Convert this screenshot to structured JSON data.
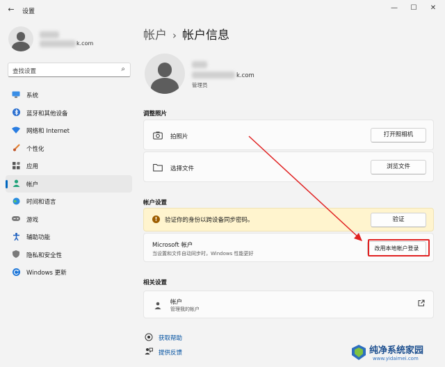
{
  "window": {
    "title": "设置",
    "back_icon": "back-arrow-icon",
    "minimize_icon": "minimize-icon",
    "maximize_icon": "maximize-icon",
    "close_icon": "close-icon"
  },
  "profile": {
    "email_suffix": "k.com"
  },
  "search": {
    "placeholder": "查找设置"
  },
  "sidebar": {
    "items": [
      {
        "label": "系统",
        "icon": "system-icon",
        "active": false
      },
      {
        "label": "蓝牙和其他设备",
        "icon": "bluetooth-icon",
        "active": false
      },
      {
        "label": "网络和 Internet",
        "icon": "network-icon",
        "active": false
      },
      {
        "label": "个性化",
        "icon": "brush-icon",
        "active": false
      },
      {
        "label": "应用",
        "icon": "apps-icon",
        "active": false
      },
      {
        "label": "帐户",
        "icon": "account-icon",
        "active": true
      },
      {
        "label": "时间和语言",
        "icon": "globe-icon",
        "active": false
      },
      {
        "label": "游戏",
        "icon": "gamepad-icon",
        "active": false
      },
      {
        "label": "辅助功能",
        "icon": "accessibility-icon",
        "active": false
      },
      {
        "label": "隐私和安全性",
        "icon": "shield-icon",
        "active": false
      },
      {
        "label": "Windows 更新",
        "icon": "update-icon",
        "active": false
      }
    ]
  },
  "breadcrumb": {
    "parent": "帐户",
    "separator": "›",
    "current": "帐户信息"
  },
  "account": {
    "email_suffix": "k.com",
    "role": "管理员"
  },
  "photo_section": {
    "heading": "调整照片",
    "rows": [
      {
        "label": "拍照片",
        "icon": "camera-icon",
        "button": "打开照相机"
      },
      {
        "label": "选择文件",
        "icon": "folder-icon",
        "button": "浏览文件"
      }
    ]
  },
  "account_settings": {
    "heading": "帐户设置",
    "warning": {
      "text": "验证你的身份以跨设备同步密码。",
      "icon": "warning-icon",
      "button": "验证"
    },
    "microsoft": {
      "title": "Microsoft 帐户",
      "subtitle": "当设置和文件自动同步时，Windows 性能更好",
      "button": "改用本地帐户登录"
    }
  },
  "related": {
    "heading": "相关设置",
    "item": {
      "title": "帐户",
      "subtitle": "管理我的帐户",
      "icon": "person-icon",
      "ext_icon": "external-link-icon"
    }
  },
  "links": [
    {
      "label": "获取帮助",
      "icon": "help-icon"
    },
    {
      "label": "提供反馈",
      "icon": "feedback-icon"
    }
  ],
  "watermark": {
    "title": "纯净系统家园",
    "url": "www.yidaimei.com"
  },
  "colors": {
    "accent": "#0067c0",
    "annotation_red": "#e02020",
    "warning_bg": "#fff4ce"
  }
}
